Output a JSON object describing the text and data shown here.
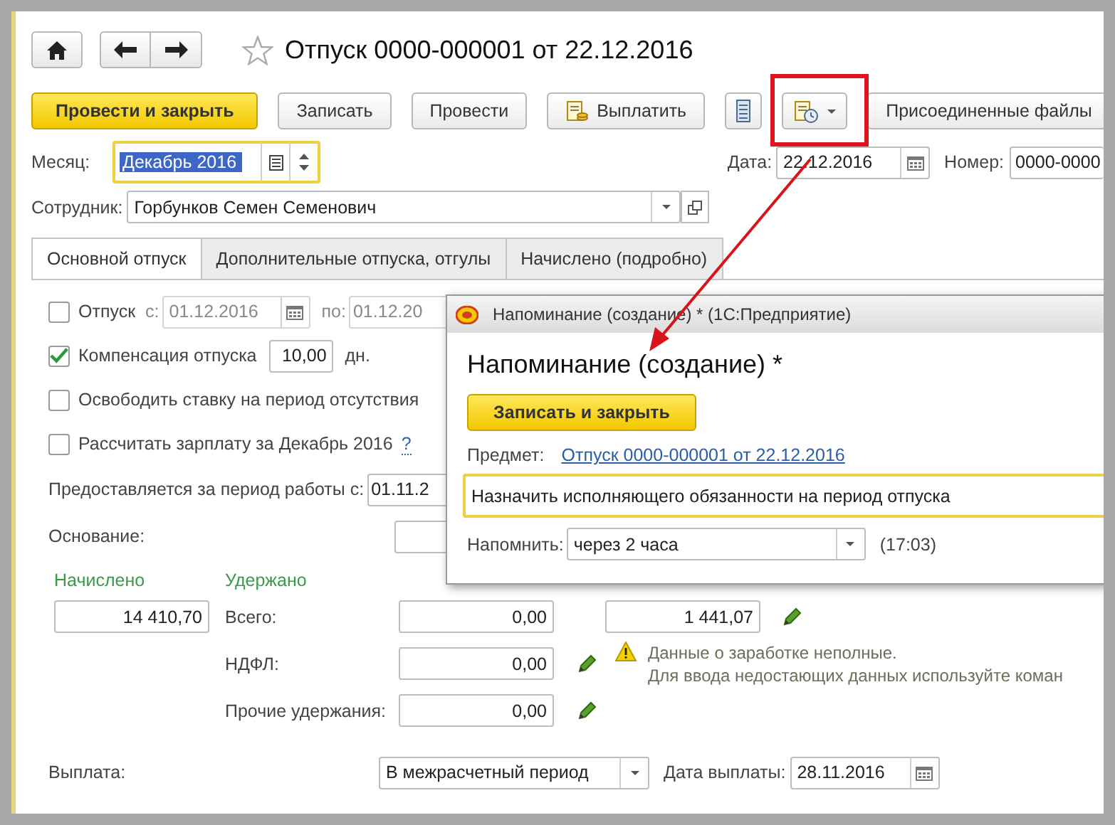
{
  "header": {
    "title": "Отпуск 0000-000001 от 22.12.2016",
    "favorite": false
  },
  "toolbar": [
    {
      "kind": "primary",
      "label": "Провести и закрыть"
    },
    {
      "kind": "text",
      "label": "Записать"
    },
    {
      "kind": "text",
      "label": "Провести"
    },
    {
      "kind": "icon_text",
      "label": "Выплатить"
    },
    {
      "kind": "icon"
    },
    {
      "kind": "icon_menu"
    },
    {
      "kind": "text",
      "label": "Присоединенные файлы"
    }
  ],
  "month": {
    "label": "Месяц:",
    "value": "Декабрь 2016",
    "text_selected": true
  },
  "date": {
    "label": "Дата:",
    "value": "22.12.2016"
  },
  "number": {
    "label": "Номер:",
    "value": "0000-0000"
  },
  "employee": {
    "label": "Сотрудник:",
    "value": "Горбунков Семен Семенович"
  },
  "tabs": [
    {
      "label": "Основной отпуск",
      "selected": true
    },
    {
      "label": "Дополнительные отпуска, отгулы",
      "selected": false
    },
    {
      "label": "Начислено (подробно)",
      "selected": false
    }
  ],
  "options": [
    {
      "kind": "period",
      "label": "Отпуск",
      "checked": false,
      "from_label": "с:",
      "from": "01.12.2016",
      "to_label": "по:",
      "to": "01.12.20"
    },
    {
      "kind": "days",
      "label": "Компенсация отпуска",
      "checked": true,
      "value": "10,00",
      "unit": "дн."
    },
    {
      "kind": "plain",
      "label": "Освободить ставку на период отсутствия",
      "checked": false
    },
    {
      "kind": "help",
      "label": "Рассчитать зарплату за Декабрь 2016",
      "checked": false,
      "help": "?"
    }
  ],
  "work_period": {
    "label": "Предоставляется за период работы с:",
    "value": "01.11.2"
  },
  "basis": {
    "label": "Основание:"
  },
  "accrued": {
    "heading": "Начислено",
    "value": "14 410,70"
  },
  "withheld": {
    "heading": "Удержано",
    "rows": [
      {
        "label": "Всего:",
        "value": "0,00",
        "editable": false
      },
      {
        "label": "НДФЛ:",
        "value": "0,00",
        "editable": true
      },
      {
        "label": "Прочие удержания:",
        "value": "0,00",
        "editable": true
      }
    ]
  },
  "average_earnings": {
    "value": "1 441,07",
    "editable": true
  },
  "warning": {
    "lines": [
      "Данные о заработке неполные.",
      "Для ввода недостающих данных используйте коман"
    ]
  },
  "payment": {
    "label": "Выплата:",
    "value": "В межрасчетный период",
    "date_label": "Дата выплаты:",
    "date": "28.11.2016"
  },
  "dialog": {
    "window_title": "Напоминание (создание) * (1С:Предприятие)",
    "heading": "Напоминание (создание) *",
    "save_button": "Записать и закрыть",
    "subject_label": "Предмет:",
    "subject_link": "Отпуск 0000-000001 от 22.12.2016",
    "text": "Назначить исполняющего обязанности на период отпуска",
    "remind_label": "Напомнить:",
    "remind_value": "через 2 часа",
    "remind_time": "(17:03)"
  }
}
